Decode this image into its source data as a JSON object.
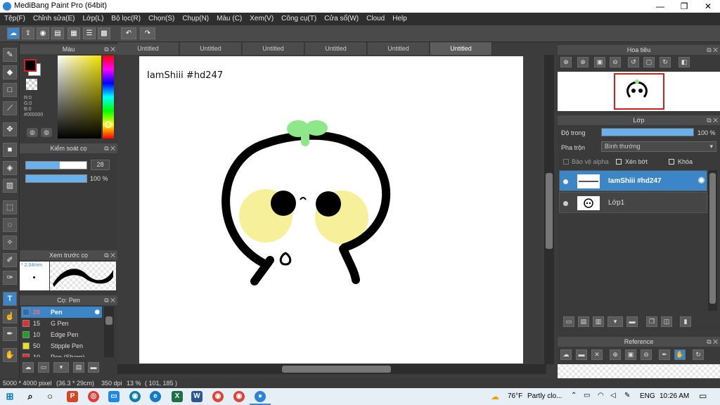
{
  "window": {
    "title": "MediBang Paint Pro (64bit)",
    "minimize": "—",
    "maximize": "❐",
    "close": "✕"
  },
  "menu": [
    "Tệp(F)",
    "Chỉnh sửa(E)",
    "Lớp(L)",
    "Bộ lọc(R)",
    "Chọn(S)",
    "Chụp(N)",
    "Màu (C)",
    "Xem(V)",
    "Công cụ(T)",
    "Cửa sổ(W)",
    "Cloud",
    "Help"
  ],
  "doc_tabs": [
    "Untitled",
    "Untitled",
    "Untitled",
    "Untitled",
    "Untitled",
    "Untitled"
  ],
  "canvas": {
    "text": "IamShiii #hd247"
  },
  "color_panel": {
    "title": "Màu",
    "r": "R:0",
    "g": "G:0",
    "b": "B:0",
    "hex": "#000000"
  },
  "brush_control": {
    "title": "Kiểm soát cọ",
    "size": "28",
    "opacity": "100 %"
  },
  "brush_preview": {
    "title": "Xem trước cọ",
    "size": "* 2.04mm"
  },
  "brush_list": {
    "title": "Cọ: Pen",
    "items": [
      {
        "size": "28",
        "name": "Pen",
        "color": "#2a6fb0"
      },
      {
        "size": "15",
        "name": "G Pen",
        "color": "#e03030"
      },
      {
        "size": "10",
        "name": "Edge Pen",
        "color": "#20a020"
      },
      {
        "size": "50",
        "name": "Stipple Pen",
        "color": "#e8e020"
      },
      {
        "size": "10",
        "name": "Pen (Sharp)",
        "color": "#e03030"
      }
    ]
  },
  "navigator": {
    "title": "Hoa tiêu"
  },
  "layer_panel": {
    "title": "Lớp",
    "opacity_label": "Độ trong",
    "opacity_value": "100 %",
    "opacity_level": 1.0,
    "blend_label": "Pha trộn",
    "blend_value": "Bình thường",
    "protect_alpha": "Bảo vệ alpha",
    "clipping": "Xén bớt",
    "lock": "Khóa",
    "layers": [
      {
        "name": "IamShiii #hd247",
        "selected": true
      },
      {
        "name": "Lớp1",
        "selected": false
      }
    ]
  },
  "reference": {
    "title": "Reference"
  },
  "status": {
    "size": "5000 * 4000 pixel",
    "cm": "(36.3 * 29cm)",
    "dpi": "350 dpi",
    "zoom": "13 %",
    "coords": "( 101, 185 )"
  },
  "taskbar": {
    "weather_temp": "76°F",
    "weather_text": "Partly clo...",
    "lang": "ENG",
    "time": "10:26 AM"
  },
  "colors": {
    "accent": "#3c86c8",
    "sprout": "#8ee88a",
    "cheek": "#f7f09a"
  }
}
